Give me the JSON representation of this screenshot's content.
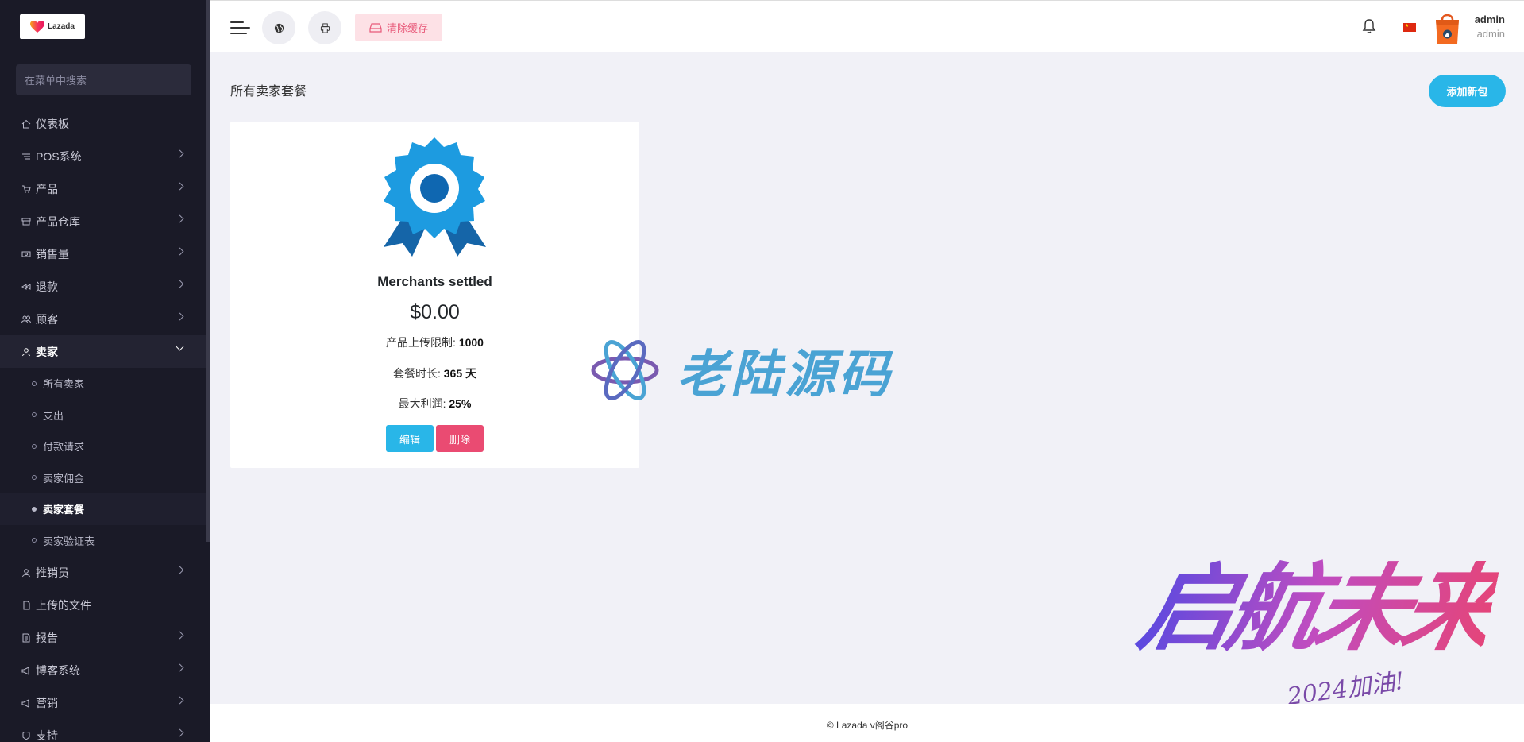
{
  "sidebar": {
    "logo_text": "Lazada",
    "search_placeholder": "在菜单中搜索",
    "items": [
      {
        "label": "仪表板",
        "icon": "home-icon",
        "chevron": false
      },
      {
        "label": "POS系统",
        "icon": "list-icon",
        "chevron": true
      },
      {
        "label": "产品",
        "icon": "cart-icon",
        "chevron": true
      },
      {
        "label": "产品仓库",
        "icon": "archive-icon",
        "chevron": true
      },
      {
        "label": "销售量",
        "icon": "money-icon",
        "chevron": true
      },
      {
        "label": "退款",
        "icon": "rewind-icon",
        "chevron": true
      },
      {
        "label": "顾客",
        "icon": "users-icon",
        "chevron": true
      },
      {
        "label": "卖家",
        "icon": "user-icon",
        "chevron": true,
        "open": true
      }
    ],
    "submenu": [
      {
        "label": "所有卖家"
      },
      {
        "label": "支出"
      },
      {
        "label": "付款请求"
      },
      {
        "label": "卖家佣金"
      },
      {
        "label": "卖家套餐",
        "active": true
      },
      {
        "label": "卖家验证表"
      }
    ],
    "items_after": [
      {
        "label": "推销员",
        "icon": "user-icon",
        "chevron": true
      },
      {
        "label": "上传的文件",
        "icon": "file-icon",
        "chevron": false
      },
      {
        "label": "报告",
        "icon": "report-icon",
        "chevron": true
      },
      {
        "label": "博客系统",
        "icon": "megaphone-icon",
        "chevron": true
      },
      {
        "label": "营销",
        "icon": "megaphone-icon",
        "chevron": true
      },
      {
        "label": "支持",
        "icon": "support-icon",
        "chevron": true
      }
    ]
  },
  "header": {
    "clear_cache_label": "清除缓存",
    "user_name": "admin",
    "user_role": "admin",
    "flag": "china-flag-icon"
  },
  "main": {
    "page_title": "所有卖家套餐",
    "add_button_label": "添加新包",
    "package": {
      "name": "Merchants settled",
      "price": "$0.00",
      "upload_limit_label": "产品上传限制:",
      "upload_limit_value": "1000",
      "duration_label": "套餐时长:",
      "duration_value": "365 天",
      "max_profit_label": "最大利润:",
      "max_profit_value": "25%",
      "edit_label": "编辑",
      "delete_label": "删除"
    }
  },
  "watermarks": {
    "center_text": "老陆源码",
    "corner_text": "启航未来",
    "corner_sub": "2024加油!"
  },
  "footer": {
    "text": "© Lazada v阁谷pro"
  },
  "colors": {
    "sidebar_bg": "#1a1a27",
    "accent_blue": "#29b6e8",
    "danger_pink": "#ea4b72",
    "clear_cache_bg": "#fde1e6"
  }
}
